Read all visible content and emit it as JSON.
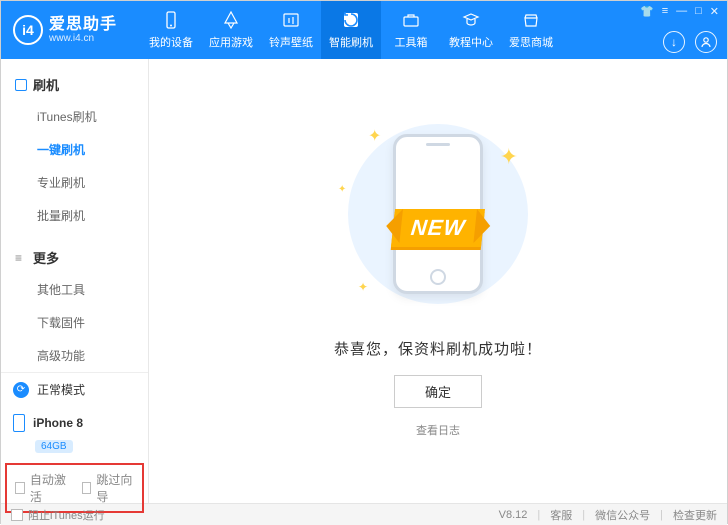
{
  "app": {
    "name": "爱思助手",
    "url": "www.i4.cn",
    "logo_text": "i4"
  },
  "nav": [
    {
      "label": "我的设备",
      "icon": "device"
    },
    {
      "label": "应用游戏",
      "icon": "apps"
    },
    {
      "label": "铃声壁纸",
      "icon": "ringtone"
    },
    {
      "label": "智能刷机",
      "icon": "flash",
      "active": true
    },
    {
      "label": "工具箱",
      "icon": "toolbox"
    },
    {
      "label": "教程中心",
      "icon": "tutorial"
    },
    {
      "label": "爱思商城",
      "icon": "store"
    }
  ],
  "sidebar": {
    "sections": [
      {
        "title": "刷机",
        "icon": "flash-box",
        "items": [
          {
            "label": "iTunes刷机"
          },
          {
            "label": "一键刷机",
            "active": true
          },
          {
            "label": "专业刷机"
          },
          {
            "label": "批量刷机"
          }
        ]
      },
      {
        "title": "更多",
        "icon": "more",
        "items": [
          {
            "label": "其他工具"
          },
          {
            "label": "下载固件"
          },
          {
            "label": "高级功能"
          }
        ]
      }
    ],
    "mode": "正常模式",
    "device": {
      "name": "iPhone 8",
      "storage": "64GB"
    },
    "checkboxes": {
      "auto_activate": "自动激活",
      "skip_guide": "跳过向导"
    }
  },
  "main": {
    "banner": "NEW",
    "message": "恭喜您，保资料刷机成功啦！",
    "ok": "确定",
    "view_log": "查看日志"
  },
  "footer": {
    "block_itunes": "阻止iTunes运行",
    "version": "V8.12",
    "support": "客服",
    "wechat": "微信公众号",
    "update": "检查更新"
  }
}
